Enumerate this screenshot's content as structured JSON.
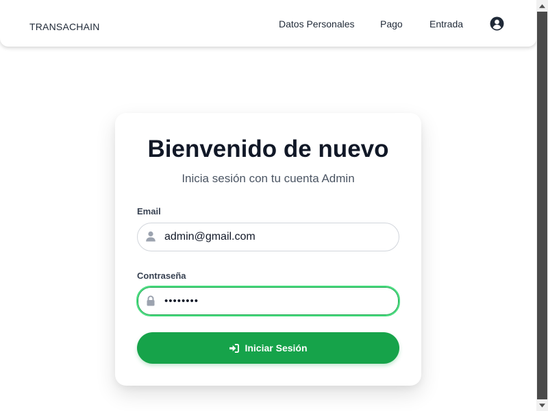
{
  "navbar": {
    "brand": "TRANSACHAIN",
    "links": [
      "Datos Personales",
      "Pago",
      "Entrada"
    ],
    "user_icon": "user-circle-icon"
  },
  "login": {
    "title": "Bienvenido de nuevo",
    "subtitle": "Inicia sesión con tu cuenta Admin",
    "email_label": "Email",
    "email_value": "admin@gmail.com",
    "password_label": "Contraseña",
    "password_value": "12345678",
    "submit_label": "Iniciar Sesión",
    "submit_icon": "sign-in-icon"
  },
  "colors": {
    "accent": "#16a34a",
    "focus_ring": "#4ade80",
    "title": "#111827"
  }
}
